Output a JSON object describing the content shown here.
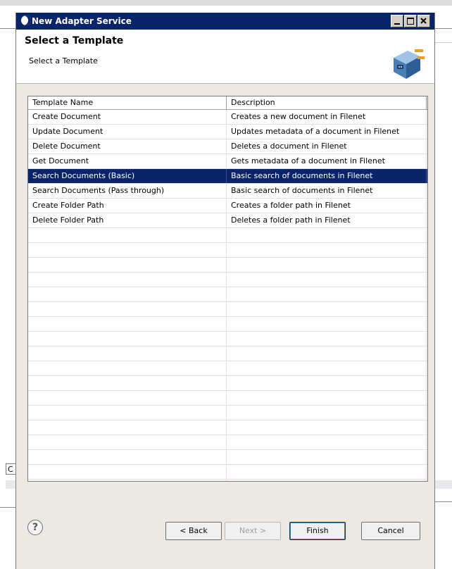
{
  "window": {
    "title": "New Adapter Service",
    "controls": [
      "minimize-icon",
      "maximize-icon",
      "close-icon"
    ]
  },
  "header": {
    "title": "Select a Template",
    "subtitle": "Select a Template",
    "icon": "adapter-plug-icon"
  },
  "table": {
    "columns": [
      "Template Name",
      "Description"
    ],
    "rows": [
      {
        "name": "Create Document",
        "description": "Creates a new document in Filenet",
        "selected": false
      },
      {
        "name": "Update Document",
        "description": "Updates metadata of a document in Filenet",
        "selected": false
      },
      {
        "name": "Delete Document",
        "description": "Deletes a document in Filenet",
        "selected": false
      },
      {
        "name": "Get Document",
        "description": "Gets metadata of a document in Filenet",
        "selected": false
      },
      {
        "name": "Search Documents (Basic)",
        "description": "Basic search of documents in Filenet",
        "selected": true
      },
      {
        "name": "Search Documents (Pass through)",
        "description": "Basic search of documents in Filenet",
        "selected": false
      },
      {
        "name": "Create Folder Path",
        "description": "Creates a folder path in Filenet",
        "selected": false
      },
      {
        "name": "Delete Folder Path",
        "description": "Deletes a folder path in Filenet",
        "selected": false
      }
    ]
  },
  "footer": {
    "help": "?",
    "back_label": "< Back",
    "next_label": "Next >",
    "finish_label": "Finish",
    "cancel_label": "Cancel"
  },
  "background": {
    "left_fragment": "C"
  },
  "colors": {
    "titlebar": "#0a246a",
    "selection": "#0a246a",
    "dialog_bg": "#ece9e4"
  }
}
